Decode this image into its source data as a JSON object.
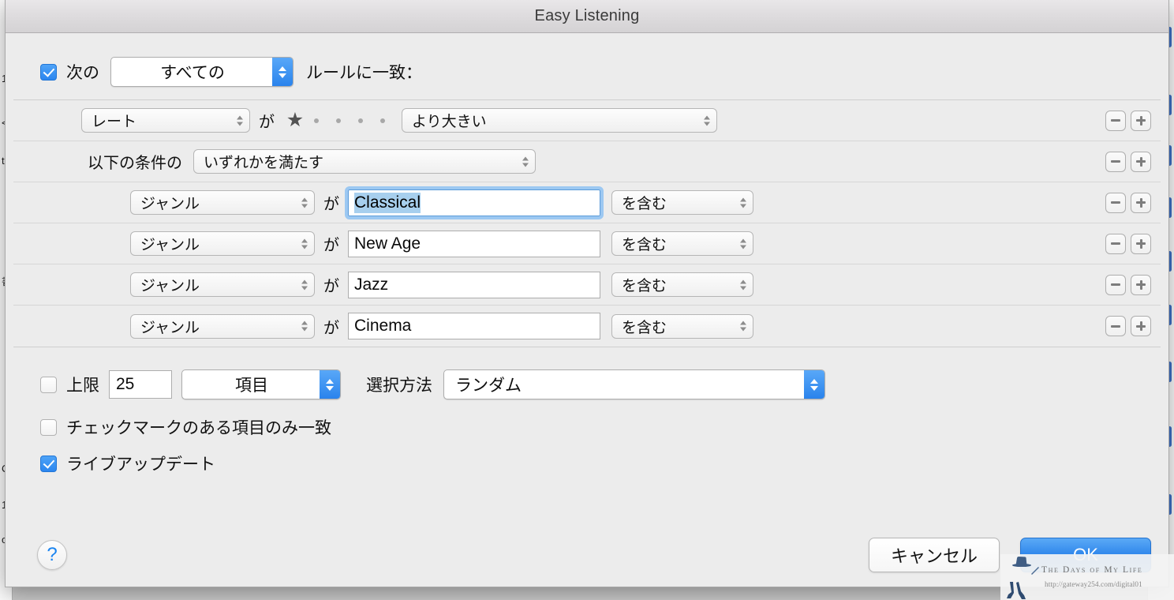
{
  "window": {
    "title": "Easy Listening"
  },
  "match": {
    "checkbox_checked": true,
    "prefix_label": "次の",
    "selected": "すべての",
    "suffix_label": "ルールに一致："
  },
  "rules": [
    {
      "type": "rating",
      "field": "レート",
      "ga": "が",
      "rating_filled": 1,
      "rating_total": 5,
      "operator": "より大きい",
      "remove_label": "−",
      "add_label": "+"
    },
    {
      "type": "group",
      "prefix_label": "以下の条件の",
      "group_operator": "いずれかを満たす",
      "remove_label": "−",
      "add_label": "+"
    },
    {
      "type": "text",
      "field": "ジャンル",
      "ga": "が",
      "value": "Classical",
      "focused": true,
      "operator": "を含む",
      "remove_label": "−",
      "add_label": "+"
    },
    {
      "type": "text",
      "field": "ジャンル",
      "ga": "が",
      "value": "New Age",
      "focused": false,
      "operator": "を含む",
      "remove_label": "−",
      "add_label": "+"
    },
    {
      "type": "text",
      "field": "ジャンル",
      "ga": "が",
      "value": "Jazz",
      "focused": false,
      "operator": "を含む",
      "remove_label": "−",
      "add_label": "+"
    },
    {
      "type": "text",
      "field": "ジャンル",
      "ga": "が",
      "value": "Cinema",
      "focused": false,
      "operator": "を含む",
      "remove_label": "−",
      "add_label": "+"
    }
  ],
  "options": {
    "limit_checked": false,
    "limit_label": "上限",
    "limit_value": "25",
    "limit_unit": "項目",
    "select_by_label": "選択方法",
    "select_by_value": "ランダム",
    "checked_only_checked": false,
    "checked_only_label": "チェックマークのある項目のみ一致",
    "live_update_checked": true,
    "live_update_label": "ライブアップデート"
  },
  "footer": {
    "help_label": "?",
    "cancel_label": "キャンセル",
    "ok_label": "OK"
  },
  "watermark": {
    "title": "The Days of My Life",
    "url": "http://gateway254.com/digital01"
  },
  "background_windows": {
    "left_fragments": [
      "1",
      "<",
      "t",
      "書",
      "C",
      "1",
      "o"
    ],
    "right_scrollbar": true
  },
  "colors": {
    "accent_blue": "#2b83ea",
    "selection_blue": "#a7cfee",
    "dialog_bg": "#ececec",
    "titlebar_bg": "#dedcde"
  }
}
